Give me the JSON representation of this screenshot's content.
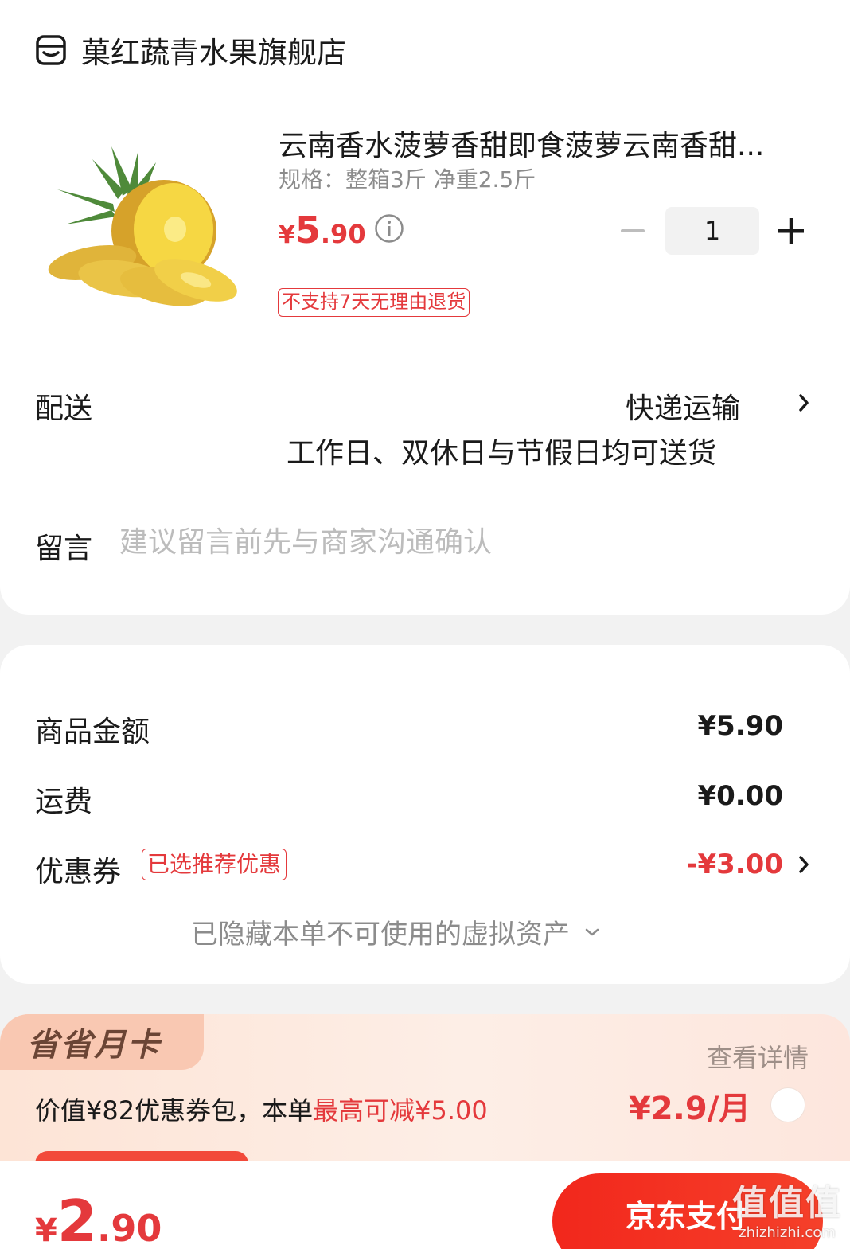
{
  "store": {
    "name": "菓红蔬青水果旗舰店",
    "icon": "store-icon"
  },
  "product": {
    "title": "云南香水菠萝香甜即食菠萝云南香甜...",
    "spec": "规格：整箱3斤 净重2.5斤",
    "price_currency": "¥",
    "price_int": "5",
    "price_dec": ".90",
    "quantity": "1",
    "return_tag": "不支持7天无理由退货"
  },
  "delivery": {
    "label": "配送",
    "method": "快递运输",
    "note": "工作日、双休日与节假日均可送货"
  },
  "message": {
    "label": "留言",
    "placeholder": "建议留言前先与商家沟通确认"
  },
  "summary": {
    "goods_label": "商品金额",
    "goods_value": "¥5.90",
    "shipping_label": "运费",
    "shipping_value": "¥0.00",
    "coupon_label": "优惠券",
    "coupon_tag": "已选推荐优惠",
    "coupon_value": "-¥3.00",
    "hidden_assets": "已隐藏本单不可使用的虚拟资产"
  },
  "monthly_card": {
    "badge": "省省月卡",
    "detail_link": "查看详情",
    "desc_prefix": "价值¥82优惠券包，本单",
    "desc_highlight": "最高可减¥5.00",
    "price": "¥2.9/月"
  },
  "footer": {
    "total_currency": "¥",
    "total_int": "2",
    "total_dec": ".90",
    "pay_label": "京东支付",
    "watermark_logo": "值值值",
    "watermark_url": "zhizhizhi.com"
  },
  "colors": {
    "accent": "#e4393c",
    "pay_button": "#f2271c",
    "muted": "#8c8c8c"
  }
}
